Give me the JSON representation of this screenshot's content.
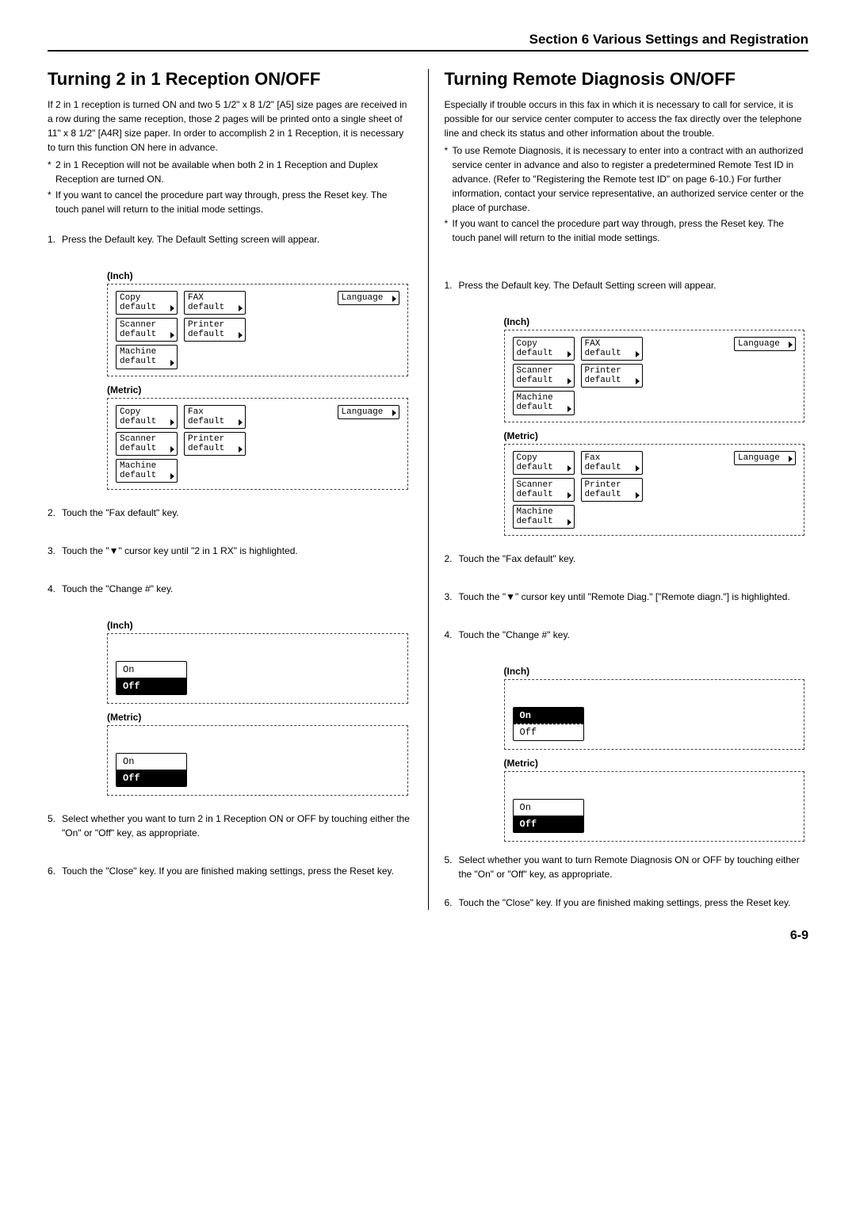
{
  "section_header": "Section 6  Various Settings and Registration",
  "page_number": "6-9",
  "left": {
    "title": "Turning 2 in 1 Reception ON/OFF",
    "intro": "If 2 in 1 reception is turned ON and two 5 1/2\" x 8 1/2\" [A5] size pages are received in a row during the same reception, those 2 pages will be printed onto a single sheet of 11\" x 8 1/2\" [A4R] size paper. In order to accomplish 2 in 1 Reception, it is necessary to turn this function ON here in advance.",
    "notes": [
      "2 in 1 Reception will not be available when both 2 in 1 Reception and Duplex Reception are turned ON.",
      "If you want to cancel the procedure part way through, press the Reset key. The touch panel will return to the initial mode settings."
    ],
    "steps": {
      "s1": "Press the Default key. The Default Setting screen will appear.",
      "s2": "Touch the \"Fax default\" key.",
      "s3": "Touch the \"▼\" cursor key until \"2 in 1 RX\" is highlighted.",
      "s4": "Touch the \"Change #\" key.",
      "s5": "Select whether you want to turn 2 in 1 Reception ON or OFF by touching either the \"On\" or \"Off\" key, as appropriate.",
      "s6": "Touch the \"Close\" key. If you are finished making settings, press the Reset key."
    },
    "panels": {
      "inch_label": "(Inch)",
      "metric_label": "(Metric)",
      "inch_buttons": {
        "copy": "Copy\ndefault",
        "fax": "FAX\ndefault",
        "scanner": "Scanner\ndefault",
        "printer": "Printer\ndefault",
        "machine": "Machine\ndefault",
        "language": "Language"
      },
      "metric_buttons": {
        "copy": "Copy\ndefault",
        "fax": "Fax\ndefault",
        "scanner": "Scanner\ndefault",
        "printer": "Printer\ndefault",
        "machine": "Machine\ndefault",
        "language": "Language"
      },
      "onoff": {
        "on": "On",
        "off": "Off",
        "selected": "off"
      }
    }
  },
  "right": {
    "title": "Turning Remote Diagnosis ON/OFF",
    "intro": "Especially if trouble occurs in this fax in which it is necessary to call for service, it is possible for our service center computer to access the fax directly over the telephone line and check its status and other information about the trouble.",
    "notes": [
      "To use Remote Diagnosis, it is necessary to enter into a contract with an authorized service center in advance and also to register a predetermined Remote Test ID in advance. (Refer to \"Registering the Remote test ID\" on page 6-10.) For further information, contact your service representative, an authorized service center or the place of purchase.",
      "If you want to cancel the procedure part way through, press the Reset key. The touch panel will return to the initial mode settings."
    ],
    "steps": {
      "s1": "Press the Default key. The Default Setting screen will appear.",
      "s2": "Touch the \"Fax default\" key.",
      "s3": "Touch the \"▼\" cursor key until \"Remote Diag.\" [\"Remote diagn.\"] is highlighted.",
      "s4": "Touch the \"Change #\" key.",
      "s5": "Select whether you want to turn Remote Diagnosis ON or OFF by touching either the \"On\" or \"Off\" key, as appropriate.",
      "s6": "Touch the \"Close\" key. If you are finished making settings, press the Reset key."
    },
    "panels": {
      "inch_label": "(Inch)",
      "metric_label": "(Metric)",
      "inch_buttons": {
        "copy": "Copy\ndefault",
        "fax": "FAX\ndefault",
        "scanner": "Scanner\ndefault",
        "printer": "Printer\ndefault",
        "machine": "Machine\ndefault",
        "language": "Language"
      },
      "metric_buttons": {
        "copy": "Copy\ndefault",
        "fax": "Fax\ndefault",
        "scanner": "Scanner\ndefault",
        "printer": "Printer\ndefault",
        "machine": "Machine\ndefault",
        "language": "Language"
      },
      "inch_onoff": {
        "on": "On",
        "off": "Off",
        "selected": "on"
      },
      "metric_onoff": {
        "on": "On",
        "off": "Off",
        "selected": "off"
      }
    }
  }
}
